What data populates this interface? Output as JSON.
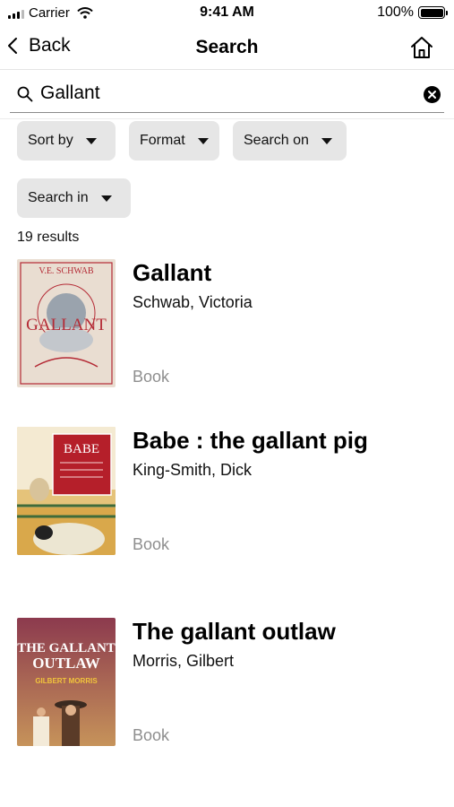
{
  "status_bar": {
    "carrier": "Carrier",
    "time": "9:41 AM",
    "battery": "100%"
  },
  "nav": {
    "back_label": "Back",
    "title": "Search"
  },
  "search": {
    "value": "Gallant",
    "placeholder": ""
  },
  "filters": {
    "sort_by": "Sort by",
    "format": "Format",
    "search_on": "Search on",
    "search_in": "Search in"
  },
  "results_count": "19 results",
  "results": [
    {
      "title": "Gallant",
      "author": "Schwab, Victoria",
      "format": "Book",
      "cover": {
        "top_text": "V.E. SCHWAB",
        "title_text": "GALLANT",
        "bg": "#e9ddd1",
        "accent": "#b42a35"
      }
    },
    {
      "title": "Babe : the gallant pig",
      "author": "King-Smith, Dick",
      "format": "Book",
      "cover": {
        "title_text": "BABE",
        "bg": "#e5c37a",
        "accent": "#b51f2a"
      }
    },
    {
      "title": "The gallant outlaw",
      "author": "Morris, Gilbert",
      "format": "Book",
      "cover": {
        "title_text": "THE GALLANT OUTLAW",
        "author_text": "GILBERT MORRIS",
        "bg": "#8c3a4e",
        "accent": "#f1c43c"
      }
    }
  ]
}
